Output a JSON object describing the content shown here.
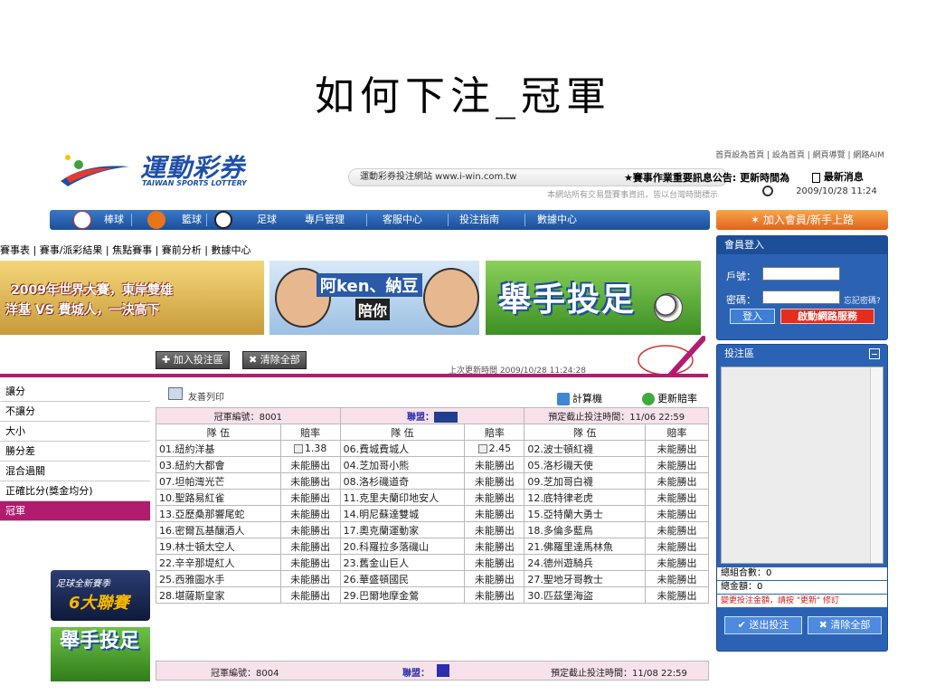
{
  "slide_title": "如何下注_冠軍",
  "header": {
    "brand": "運動彩券",
    "brand_en": "TAIWAN SPORTS LOTTERY",
    "top_links": "首頁設為首頁 | 設為首頁 | 網頁導覽 | 網路AIM",
    "site_bar": "運動彩券投注網站 www.i-win.com.tw",
    "notice": "★賽事作業重要訊息公告: 更新時間為",
    "latest_news": "最新消息",
    "sub_note": "本網站所有交易暨賽事資訊，皆以台灣時間標示",
    "clock_time": "2009/10/28 11:24"
  },
  "nav": {
    "items": [
      "棒球",
      "籃球",
      "足球",
      "專戶管理",
      "客服中心",
      "投注指南",
      "數據中心"
    ],
    "join_button": "加入會員/新手上路"
  },
  "sublinks": "賽事表 | 賽事/派彩結果 | 焦點賽事 | 賽前分析 | 數據中心",
  "banners": {
    "b1_line1": "2009年世界大賽，東岸雙雄",
    "b1_line2": "洋基 VS 費城人，一決高下",
    "b2_line1": "阿ken、納豆",
    "b2_line2": "陪你",
    "b3": "舉手投足"
  },
  "login": {
    "title": "會員登入",
    "account_label": "戶號：",
    "password_label": "密碼：",
    "forgot": "忘記密碼?",
    "login_button": "登入",
    "start_button": "啟動網路服務"
  },
  "betslip": {
    "title": "投注區",
    "total_combos": "總組合數：0",
    "total_amount": "總金額：0",
    "warning": "變更投注金額，請按 \"更新\" 修訂",
    "submit": "送出投注",
    "clear_all": "清除全部"
  },
  "toolbar": {
    "add": "加入投注區",
    "clear": "清除全部",
    "updated": "上次更新時間 2009/10/28 11:24:28",
    "print": "友善列印",
    "calc": "計算機",
    "refresh": "更新賠率"
  },
  "menu": [
    "讓分",
    "不讓分",
    "大小",
    "勝分差",
    "混合過關",
    "正確比分(獎金均分)",
    "冠軍"
  ],
  "promos": {
    "p1_line1": "足球全新賽季",
    "p1_line2": "6大聯賽",
    "p2": "舉手投足"
  },
  "table": {
    "caption": {
      "champion_no": "冠軍編號：8001",
      "league": "聯盟：",
      "deadline": "預定截止投注時間：11/06 22:59"
    },
    "headers": [
      "隊 伍",
      "賠率",
      "隊 伍",
      "賠率",
      "隊 伍",
      "賠率"
    ],
    "rows": [
      [
        "01.紐約洋基",
        "1.38",
        "06.費城費城人",
        "2.45",
        "02.波士頓紅襪",
        "未能勝出"
      ],
      [
        "03.紐約大都會",
        "未能勝出",
        "04.芝加哥小熊",
        "未能勝出",
        "05.洛杉磯天使",
        "未能勝出"
      ],
      [
        "07.坦帕灣光芒",
        "未能勝出",
        "08.洛杉磯道奇",
        "未能勝出",
        "09.芝加哥白襪",
        "未能勝出"
      ],
      [
        "10.聖路易紅雀",
        "未能勝出",
        "11.克里夫蘭印地安人",
        "未能勝出",
        "12.底特律老虎",
        "未能勝出"
      ],
      [
        "13.亞歷桑那響尾蛇",
        "未能勝出",
        "14.明尼蘇達雙城",
        "未能勝出",
        "15.亞特蘭大勇士",
        "未能勝出"
      ],
      [
        "16.密爾瓦基釀酒人",
        "未能勝出",
        "17.奧克蘭運動家",
        "未能勝出",
        "18.多倫多藍鳥",
        "未能勝出"
      ],
      [
        "19.林士頓太空人",
        "未能勝出",
        "20.科羅拉多落磯山",
        "未能勝出",
        "21.佛羅里達馬林魚",
        "未能勝出"
      ],
      [
        "22.辛辛那堤紅人",
        "未能勝出",
        "23.舊金山巨人",
        "未能勝出",
        "24.德州遊騎兵",
        "未能勝出"
      ],
      [
        "25.西雅圖水手",
        "未能勝出",
        "26.華盛頓國民",
        "未能勝出",
        "27.聖地牙哥教士",
        "未能勝出"
      ],
      [
        "28.堪薩斯皇家",
        "未能勝出",
        "29.巴爾地摩金鶯",
        "未能勝出",
        "30.匹茲堡海盜",
        "未能勝出"
      ]
    ],
    "caption2": {
      "champion_no": "冠軍編號：8004",
      "league": "聯盟：",
      "deadline": "預定截止投注時間：11/08 22:59"
    }
  },
  "colors": {
    "accent": "#b11c6f",
    "nav_blue": "#1b4e99",
    "join_orange": "#e0631b"
  }
}
